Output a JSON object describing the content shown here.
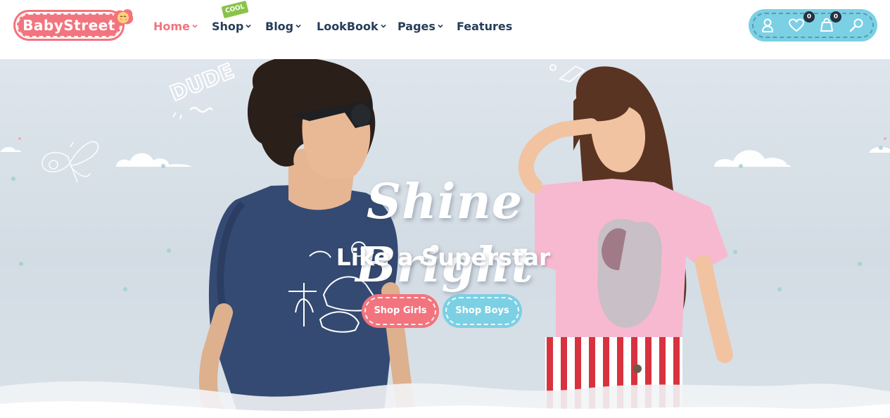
{
  "logo": {
    "text": "BabyStreet"
  },
  "nav": {
    "items": [
      {
        "label": "Home",
        "active": true,
        "dropdown": true
      },
      {
        "label": "Shop",
        "active": false,
        "dropdown": true,
        "badge": "COOL"
      },
      {
        "label": "Blog",
        "active": false,
        "dropdown": true
      },
      {
        "label": "LookBook",
        "active": false,
        "dropdown": true
      },
      {
        "label": "Pages",
        "active": false,
        "dropdown": true
      },
      {
        "label": "Features",
        "active": false,
        "dropdown": false
      }
    ]
  },
  "header_actions": {
    "icons": [
      "user-icon",
      "heart-icon",
      "shopping-bag-icon",
      "search-icon"
    ],
    "wishlist_count": "0",
    "cart_count": "0"
  },
  "hero": {
    "headline": "Shine Bright",
    "subline": "Like a Superstar",
    "buttons": {
      "girls": "Shop Girls",
      "boys": "Shop Boys"
    },
    "doodle_text": "DUDE"
  },
  "colors": {
    "brand_pink": "#f2747e",
    "brand_blue": "#7bd0e4",
    "nav_text": "#263d5a",
    "hero_bg": "#dee5ec"
  }
}
